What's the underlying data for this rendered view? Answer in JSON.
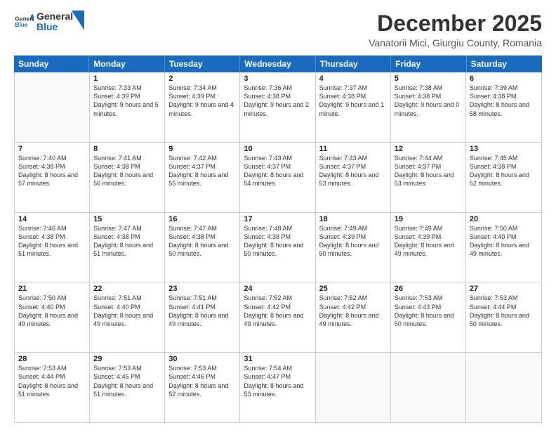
{
  "header": {
    "logo_general": "General",
    "logo_blue": "Blue",
    "month": "December 2025",
    "location": "Vanatorii Mici, Giurgiu County, Romania"
  },
  "days_of_week": [
    "Sunday",
    "Monday",
    "Tuesday",
    "Wednesday",
    "Thursday",
    "Friday",
    "Saturday"
  ],
  "weeks": [
    [
      {
        "day": "",
        "sunrise": "",
        "sunset": "",
        "daylight": "",
        "empty": true
      },
      {
        "day": "1",
        "sunrise": "Sunrise: 7:33 AM",
        "sunset": "Sunset: 4:39 PM",
        "daylight": "Daylight: 9 hours and 5 minutes."
      },
      {
        "day": "2",
        "sunrise": "Sunrise: 7:34 AM",
        "sunset": "Sunset: 4:39 PM",
        "daylight": "Daylight: 9 hours and 4 minutes."
      },
      {
        "day": "3",
        "sunrise": "Sunrise: 7:36 AM",
        "sunset": "Sunset: 4:38 PM",
        "daylight": "Daylight: 9 hours and 2 minutes."
      },
      {
        "day": "4",
        "sunrise": "Sunrise: 7:37 AM",
        "sunset": "Sunset: 4:38 PM",
        "daylight": "Daylight: 9 hours and 1 minute."
      },
      {
        "day": "5",
        "sunrise": "Sunrise: 7:38 AM",
        "sunset": "Sunset: 4:38 PM",
        "daylight": "Daylight: 9 hours and 0 minutes."
      },
      {
        "day": "6",
        "sunrise": "Sunrise: 7:39 AM",
        "sunset": "Sunset: 4:38 PM",
        "daylight": "Daylight: 8 hours and 58 minutes."
      }
    ],
    [
      {
        "day": "7",
        "sunrise": "Sunrise: 7:40 AM",
        "sunset": "Sunset: 4:38 PM",
        "daylight": "Daylight: 8 hours and 57 minutes."
      },
      {
        "day": "8",
        "sunrise": "Sunrise: 7:41 AM",
        "sunset": "Sunset: 4:38 PM",
        "daylight": "Daylight: 8 hours and 56 minutes."
      },
      {
        "day": "9",
        "sunrise": "Sunrise: 7:42 AM",
        "sunset": "Sunset: 4:37 PM",
        "daylight": "Daylight: 8 hours and 55 minutes."
      },
      {
        "day": "10",
        "sunrise": "Sunrise: 7:43 AM",
        "sunset": "Sunset: 4:37 PM",
        "daylight": "Daylight: 8 hours and 54 minutes."
      },
      {
        "day": "11",
        "sunrise": "Sunrise: 7:43 AM",
        "sunset": "Sunset: 4:37 PM",
        "daylight": "Daylight: 8 hours and 53 minutes."
      },
      {
        "day": "12",
        "sunrise": "Sunrise: 7:44 AM",
        "sunset": "Sunset: 4:37 PM",
        "daylight": "Daylight: 8 hours and 53 minutes."
      },
      {
        "day": "13",
        "sunrise": "Sunrise: 7:45 AM",
        "sunset": "Sunset: 4:38 PM",
        "daylight": "Daylight: 8 hours and 52 minutes."
      }
    ],
    [
      {
        "day": "14",
        "sunrise": "Sunrise: 7:46 AM",
        "sunset": "Sunset: 4:38 PM",
        "daylight": "Daylight: 8 hours and 51 minutes."
      },
      {
        "day": "15",
        "sunrise": "Sunrise: 7:47 AM",
        "sunset": "Sunset: 4:38 PM",
        "daylight": "Daylight: 8 hours and 51 minutes."
      },
      {
        "day": "16",
        "sunrise": "Sunrise: 7:47 AM",
        "sunset": "Sunset: 4:38 PM",
        "daylight": "Daylight: 8 hours and 50 minutes."
      },
      {
        "day": "17",
        "sunrise": "Sunrise: 7:48 AM",
        "sunset": "Sunset: 4:38 PM",
        "daylight": "Daylight: 8 hours and 50 minutes."
      },
      {
        "day": "18",
        "sunrise": "Sunrise: 7:49 AM",
        "sunset": "Sunset: 4:39 PM",
        "daylight": "Daylight: 8 hours and 50 minutes."
      },
      {
        "day": "19",
        "sunrise": "Sunrise: 7:49 AM",
        "sunset": "Sunset: 4:39 PM",
        "daylight": "Daylight: 8 hours and 49 minutes."
      },
      {
        "day": "20",
        "sunrise": "Sunrise: 7:50 AM",
        "sunset": "Sunset: 4:40 PM",
        "daylight": "Daylight: 8 hours and 49 minutes."
      }
    ],
    [
      {
        "day": "21",
        "sunrise": "Sunrise: 7:50 AM",
        "sunset": "Sunset: 4:40 PM",
        "daylight": "Daylight: 8 hours and 49 minutes."
      },
      {
        "day": "22",
        "sunrise": "Sunrise: 7:51 AM",
        "sunset": "Sunset: 4:40 PM",
        "daylight": "Daylight: 8 hours and 49 minutes."
      },
      {
        "day": "23",
        "sunrise": "Sunrise: 7:51 AM",
        "sunset": "Sunset: 4:41 PM",
        "daylight": "Daylight: 8 hours and 49 minutes."
      },
      {
        "day": "24",
        "sunrise": "Sunrise: 7:52 AM",
        "sunset": "Sunset: 4:42 PM",
        "daylight": "Daylight: 8 hours and 49 minutes."
      },
      {
        "day": "25",
        "sunrise": "Sunrise: 7:52 AM",
        "sunset": "Sunset: 4:42 PM",
        "daylight": "Daylight: 8 hours and 49 minutes."
      },
      {
        "day": "26",
        "sunrise": "Sunrise: 7:53 AM",
        "sunset": "Sunset: 4:43 PM",
        "daylight": "Daylight: 8 hours and 50 minutes."
      },
      {
        "day": "27",
        "sunrise": "Sunrise: 7:53 AM",
        "sunset": "Sunset: 4:44 PM",
        "daylight": "Daylight: 8 hours and 50 minutes."
      }
    ],
    [
      {
        "day": "28",
        "sunrise": "Sunrise: 7:53 AM",
        "sunset": "Sunset: 4:44 PM",
        "daylight": "Daylight: 8 hours and 51 minutes."
      },
      {
        "day": "29",
        "sunrise": "Sunrise: 7:53 AM",
        "sunset": "Sunset: 4:45 PM",
        "daylight": "Daylight: 8 hours and 51 minutes."
      },
      {
        "day": "30",
        "sunrise": "Sunrise: 7:53 AM",
        "sunset": "Sunset: 4:46 PM",
        "daylight": "Daylight: 8 hours and 52 minutes."
      },
      {
        "day": "31",
        "sunrise": "Sunrise: 7:54 AM",
        "sunset": "Sunset: 4:47 PM",
        "daylight": "Daylight: 8 hours and 53 minutes."
      },
      {
        "day": "",
        "sunrise": "",
        "sunset": "",
        "daylight": "",
        "empty": true
      },
      {
        "day": "",
        "sunrise": "",
        "sunset": "",
        "daylight": "",
        "empty": true
      },
      {
        "day": "",
        "sunrise": "",
        "sunset": "",
        "daylight": "",
        "empty": true
      }
    ]
  ]
}
